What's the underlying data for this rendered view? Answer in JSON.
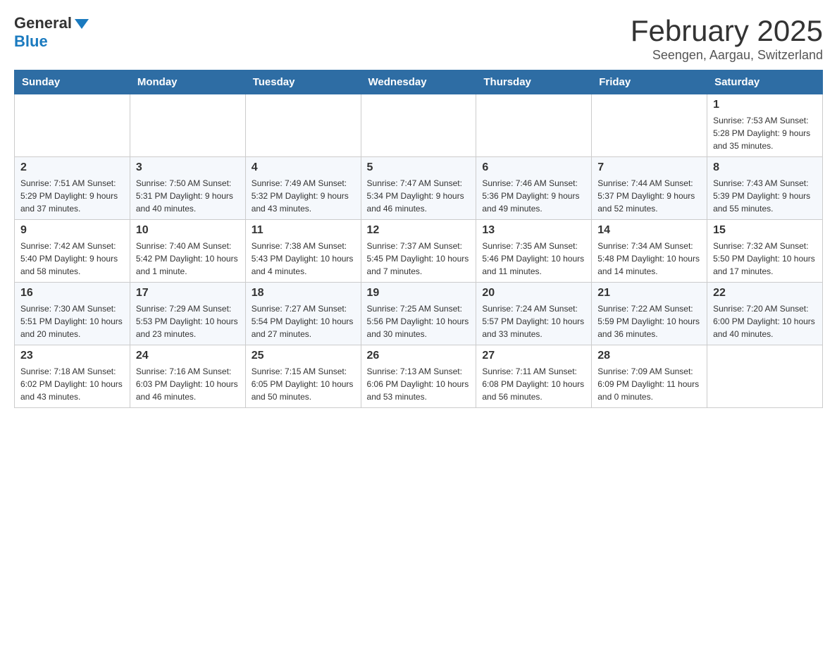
{
  "logo": {
    "text_general": "General",
    "text_blue": "Blue"
  },
  "title": {
    "month_year": "February 2025",
    "location": "Seengen, Aargau, Switzerland"
  },
  "weekdays": [
    "Sunday",
    "Monday",
    "Tuesday",
    "Wednesday",
    "Thursday",
    "Friday",
    "Saturday"
  ],
  "weeks": [
    [
      {
        "day": "",
        "info": ""
      },
      {
        "day": "",
        "info": ""
      },
      {
        "day": "",
        "info": ""
      },
      {
        "day": "",
        "info": ""
      },
      {
        "day": "",
        "info": ""
      },
      {
        "day": "",
        "info": ""
      },
      {
        "day": "1",
        "info": "Sunrise: 7:53 AM\nSunset: 5:28 PM\nDaylight: 9 hours and 35 minutes."
      }
    ],
    [
      {
        "day": "2",
        "info": "Sunrise: 7:51 AM\nSunset: 5:29 PM\nDaylight: 9 hours and 37 minutes."
      },
      {
        "day": "3",
        "info": "Sunrise: 7:50 AM\nSunset: 5:31 PM\nDaylight: 9 hours and 40 minutes."
      },
      {
        "day": "4",
        "info": "Sunrise: 7:49 AM\nSunset: 5:32 PM\nDaylight: 9 hours and 43 minutes."
      },
      {
        "day": "5",
        "info": "Sunrise: 7:47 AM\nSunset: 5:34 PM\nDaylight: 9 hours and 46 minutes."
      },
      {
        "day": "6",
        "info": "Sunrise: 7:46 AM\nSunset: 5:36 PM\nDaylight: 9 hours and 49 minutes."
      },
      {
        "day": "7",
        "info": "Sunrise: 7:44 AM\nSunset: 5:37 PM\nDaylight: 9 hours and 52 minutes."
      },
      {
        "day": "8",
        "info": "Sunrise: 7:43 AM\nSunset: 5:39 PM\nDaylight: 9 hours and 55 minutes."
      }
    ],
    [
      {
        "day": "9",
        "info": "Sunrise: 7:42 AM\nSunset: 5:40 PM\nDaylight: 9 hours and 58 minutes."
      },
      {
        "day": "10",
        "info": "Sunrise: 7:40 AM\nSunset: 5:42 PM\nDaylight: 10 hours and 1 minute."
      },
      {
        "day": "11",
        "info": "Sunrise: 7:38 AM\nSunset: 5:43 PM\nDaylight: 10 hours and 4 minutes."
      },
      {
        "day": "12",
        "info": "Sunrise: 7:37 AM\nSunset: 5:45 PM\nDaylight: 10 hours and 7 minutes."
      },
      {
        "day": "13",
        "info": "Sunrise: 7:35 AM\nSunset: 5:46 PM\nDaylight: 10 hours and 11 minutes."
      },
      {
        "day": "14",
        "info": "Sunrise: 7:34 AM\nSunset: 5:48 PM\nDaylight: 10 hours and 14 minutes."
      },
      {
        "day": "15",
        "info": "Sunrise: 7:32 AM\nSunset: 5:50 PM\nDaylight: 10 hours and 17 minutes."
      }
    ],
    [
      {
        "day": "16",
        "info": "Sunrise: 7:30 AM\nSunset: 5:51 PM\nDaylight: 10 hours and 20 minutes."
      },
      {
        "day": "17",
        "info": "Sunrise: 7:29 AM\nSunset: 5:53 PM\nDaylight: 10 hours and 23 minutes."
      },
      {
        "day": "18",
        "info": "Sunrise: 7:27 AM\nSunset: 5:54 PM\nDaylight: 10 hours and 27 minutes."
      },
      {
        "day": "19",
        "info": "Sunrise: 7:25 AM\nSunset: 5:56 PM\nDaylight: 10 hours and 30 minutes."
      },
      {
        "day": "20",
        "info": "Sunrise: 7:24 AM\nSunset: 5:57 PM\nDaylight: 10 hours and 33 minutes."
      },
      {
        "day": "21",
        "info": "Sunrise: 7:22 AM\nSunset: 5:59 PM\nDaylight: 10 hours and 36 minutes."
      },
      {
        "day": "22",
        "info": "Sunrise: 7:20 AM\nSunset: 6:00 PM\nDaylight: 10 hours and 40 minutes."
      }
    ],
    [
      {
        "day": "23",
        "info": "Sunrise: 7:18 AM\nSunset: 6:02 PM\nDaylight: 10 hours and 43 minutes."
      },
      {
        "day": "24",
        "info": "Sunrise: 7:16 AM\nSunset: 6:03 PM\nDaylight: 10 hours and 46 minutes."
      },
      {
        "day": "25",
        "info": "Sunrise: 7:15 AM\nSunset: 6:05 PM\nDaylight: 10 hours and 50 minutes."
      },
      {
        "day": "26",
        "info": "Sunrise: 7:13 AM\nSunset: 6:06 PM\nDaylight: 10 hours and 53 minutes."
      },
      {
        "day": "27",
        "info": "Sunrise: 7:11 AM\nSunset: 6:08 PM\nDaylight: 10 hours and 56 minutes."
      },
      {
        "day": "28",
        "info": "Sunrise: 7:09 AM\nSunset: 6:09 PM\nDaylight: 11 hours and 0 minutes."
      },
      {
        "day": "",
        "info": ""
      }
    ]
  ]
}
